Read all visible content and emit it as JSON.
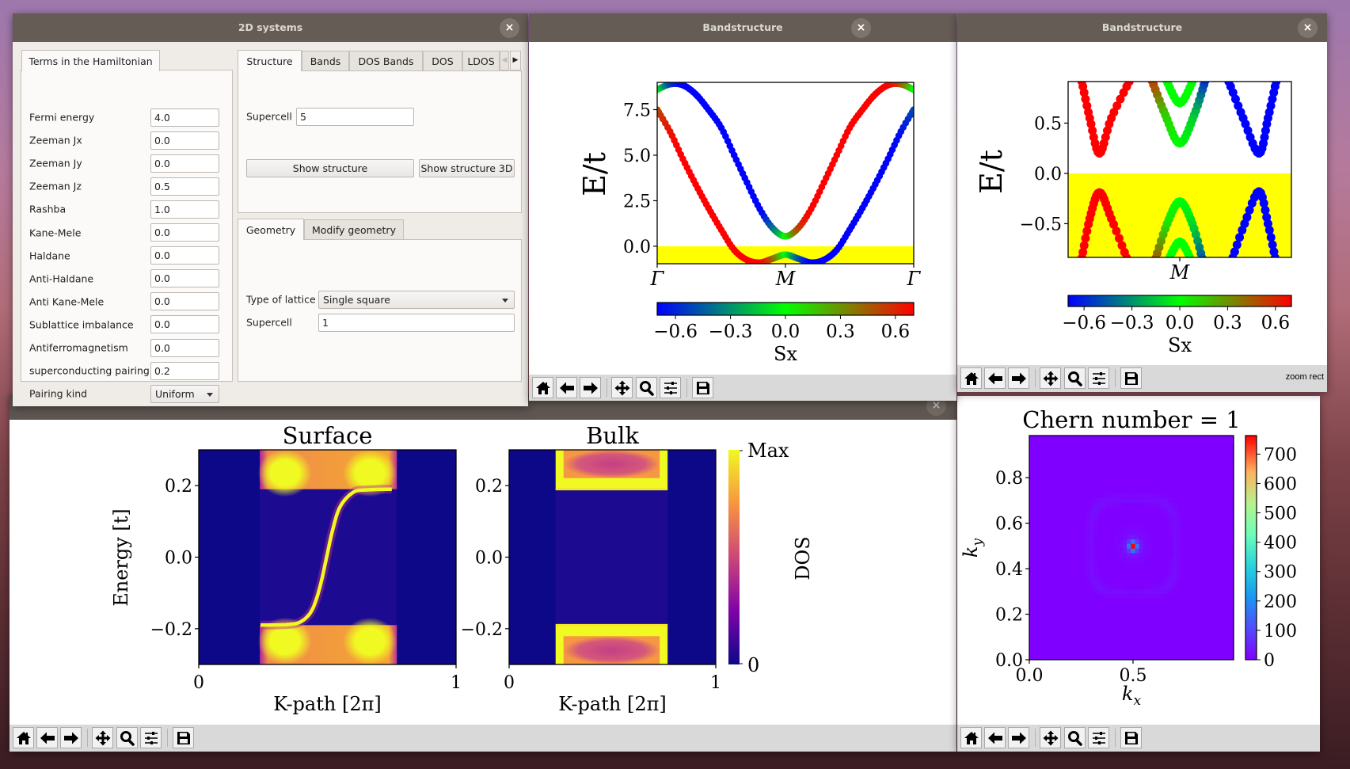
{
  "systems": {
    "title": "2D systems",
    "close_icon": "close-icon",
    "hamiltonian_tab": "Terms in the Hamiltonian",
    "params": [
      {
        "label": "Fermi energy",
        "value": "4.0"
      },
      {
        "label": "Zeeman Jx",
        "value": "0.0"
      },
      {
        "label": "Zeeman Jy",
        "value": "0.0"
      },
      {
        "label": "Zeeman Jz",
        "value": "0.5"
      },
      {
        "label": "Rashba",
        "value": "1.0"
      },
      {
        "label": "Kane-Mele",
        "value": "0.0"
      },
      {
        "label": "Haldane",
        "value": "0.0"
      },
      {
        "label": "Anti-Haldane",
        "value": "0.0"
      },
      {
        "label": "Anti Kane-Mele",
        "value": "0.0"
      },
      {
        "label": "Sublattice imbalance",
        "value": "0.0"
      },
      {
        "label": "Antiferromagnetism",
        "value": "0.0"
      },
      {
        "label": "superconducting pairing",
        "value": "0.2"
      }
    ],
    "pairing_kind": {
      "label": "Pairing kind",
      "value": "Uniform"
    },
    "top_tabs": [
      "Structure",
      "Bands",
      "DOS Bands",
      "DOS",
      "LDOS"
    ],
    "supercell_label": "Supercell",
    "supercell_value": "5",
    "show_structure": "Show structure",
    "show_structure_3d": "Show structure 3D",
    "bottom_tabs": [
      "Geometry",
      "Modify geometry"
    ],
    "lattice_label": "Type of lattice",
    "lattice_value": "Single square",
    "geom_supercell_label": "Supercell",
    "geom_supercell_value": "1"
  },
  "band1": {
    "title": "Bandstructure"
  },
  "band2": {
    "title": "Bandstructure",
    "toolbar_message": "zoom rect"
  },
  "toolbar_buttons": [
    "home-icon",
    "back-arrow-icon",
    "forward-arrow-icon",
    "pan-move-icon",
    "zoom-magnifier-icon",
    "configure-subplots-icon",
    "save-floppy-icon"
  ],
  "colors": {
    "fermi_sea": "#ffff00",
    "sx_negative": "#0000ff",
    "sx_zero": "#00ff00",
    "sx_positive": "#ff0000"
  },
  "chart_data": [
    {
      "id": "band1",
      "type": "scatter",
      "ylabel": "E/t",
      "xticklabels": [
        "Γ",
        "M",
        "Γ"
      ],
      "xticks": [
        0,
        0.5,
        1
      ],
      "xlim": [
        0,
        1
      ],
      "ylim": [
        -0.96,
        9.0
      ],
      "yticks": [
        0.0,
        2.5,
        5.0,
        7.5
      ],
      "yticklabels": [
        "0.0",
        "2.5",
        "5.0",
        "7.5"
      ],
      "filled_below_energy": 0.0,
      "colorbar": {
        "label": "Sx",
        "range": [
          -0.7,
          0.7
        ],
        "ticks": [
          -0.6,
          -0.3,
          0.0,
          0.3,
          0.6
        ],
        "ticklabels": [
          "−0.6",
          "−0.3",
          "0.0",
          "0.3",
          "0.6"
        ]
      },
      "series": [
        {
          "x": [
            0,
            0.05,
            0.1,
            0.15,
            0.2,
            0.25,
            0.3,
            0.35,
            0.4,
            0.45,
            0.5,
            0.55,
            0.6,
            0.65,
            0.7,
            0.75,
            0.8,
            0.85,
            0.9,
            0.95,
            1
          ],
          "y": [
            8.6,
            8.9,
            8.85,
            8.35,
            7.5,
            6.5,
            5.0,
            3.5,
            2.05,
            1.0,
            0.55,
            1.0,
            2.05,
            3.5,
            5.0,
            6.5,
            7.5,
            8.35,
            8.85,
            8.9,
            8.6
          ],
          "sx": [
            0,
            -0.5,
            -0.7,
            -0.7,
            -0.7,
            -0.7,
            -0.7,
            -0.7,
            -0.7,
            -0.4,
            0,
            0.5,
            0.7,
            0.7,
            0.7,
            0.7,
            0.7,
            0.7,
            0.7,
            0.5,
            0
          ]
        },
        {
          "x": [
            0,
            0.05,
            0.1,
            0.15,
            0.2,
            0.25,
            0.3,
            0.35,
            0.4,
            0.45,
            0.5,
            0.55,
            0.6,
            0.65,
            0.7,
            0.75,
            0.8,
            0.85,
            0.9,
            0.95,
            1
          ],
          "y": [
            7.5,
            6.3,
            4.8,
            3.4,
            2.1,
            0.9,
            -0.2,
            -0.75,
            -0.9,
            -0.68,
            -0.46,
            -0.68,
            -0.9,
            -0.75,
            -0.2,
            0.9,
            2.1,
            3.4,
            4.8,
            6.3,
            7.5
          ],
          "sx": [
            0.5,
            0.65,
            0.7,
            0.7,
            0.7,
            0.7,
            0.7,
            0.7,
            0.7,
            0.45,
            0,
            -0.45,
            -0.7,
            -0.7,
            -0.7,
            -0.7,
            -0.7,
            -0.7,
            -0.7,
            -0.65,
            -0.5
          ]
        }
      ]
    },
    {
      "id": "band2",
      "type": "scatter",
      "ylabel": "E/t",
      "xticklabels": [
        "M"
      ],
      "xticks": [
        0.5
      ],
      "xlim": [
        0.19,
        0.81
      ],
      "ylim": [
        -0.835,
        0.913
      ],
      "yticks": [
        -0.5,
        0.0,
        0.5
      ],
      "yticklabels": [
        "−0.5",
        "0.0",
        "0.5"
      ],
      "filled_below_energy": 0.0,
      "colorbar": {
        "label": "Sx",
        "range": [
          -0.7,
          0.7
        ],
        "ticks": [
          -0.6,
          -0.3,
          0.0,
          0.3,
          0.6
        ],
        "ticklabels": [
          "−0.6",
          "−0.3",
          "0.0",
          "0.3",
          "0.6"
        ]
      },
      "series": [
        {
          "x": [
            0.226,
            0.25,
            0.277,
            0.31,
            0.365
          ],
          "y": [
            0.95,
            0.55,
            0.2,
            0.55,
            0.95
          ],
          "sx": [
            0.7,
            0.7,
            0.7,
            0.7,
            0.7
          ]
        },
        {
          "x": [
            0.42,
            0.46,
            0.5,
            0.54,
            0.573
          ],
          "y": [
            0.95,
            0.58,
            0.3,
            0.58,
            0.95
          ],
          "sx": [
            0.6,
            0.15,
            0,
            -0.15,
            -0.6
          ]
        },
        {
          "x": [
            0.46,
            0.5,
            0.54
          ],
          "y": [
            0.95,
            0.7,
            0.95
          ],
          "sx": [
            0,
            0,
            0
          ]
        },
        {
          "x": [
            0.632,
            0.676,
            0.72,
            0.745,
            0.77
          ],
          "y": [
            0.95,
            0.55,
            0.2,
            0.55,
            0.95
          ],
          "sx": [
            -0.7,
            -0.7,
            -0.7,
            -0.7,
            -0.7
          ]
        },
        {
          "x": [
            0.226,
            0.25,
            0.277,
            0.31,
            0.357
          ],
          "y": [
            -0.88,
            -0.45,
            -0.19,
            -0.45,
            -0.88
          ],
          "sx": [
            0.7,
            0.7,
            0.7,
            0.7,
            0.7
          ]
        },
        {
          "x": [
            0.43,
            0.465,
            0.5,
            0.535,
            0.565
          ],
          "y": [
            -0.88,
            -0.5,
            -0.28,
            -0.5,
            -0.88
          ],
          "sx": [
            0.5,
            0.1,
            0,
            -0.1,
            -0.5
          ]
        },
        {
          "x": [
            0.466,
            0.5,
            0.534
          ],
          "y": [
            -0.88,
            -0.68,
            -0.88
          ],
          "sx": [
            0,
            0,
            0
          ]
        },
        {
          "x": [
            0.643,
            0.68,
            0.72,
            0.745,
            0.767
          ],
          "y": [
            -0.88,
            -0.5,
            -0.18,
            -0.5,
            -0.88
          ],
          "sx": [
            -0.7,
            -0.7,
            -0.7,
            -0.7,
            -0.7
          ]
        }
      ]
    },
    {
      "id": "surface",
      "type": "heatmap",
      "title": "Surface",
      "xlabel": "K-path [2π]",
      "ylabel": "Energy [t]",
      "xlim": [
        0,
        1
      ],
      "ylim": [
        -0.3,
        0.3
      ],
      "xticks": [
        0,
        1
      ],
      "xticklabels": [
        "0",
        "1"
      ],
      "yticks": [
        -0.2,
        0.0,
        0.2
      ],
      "yticklabels": [
        "−0.2",
        "0.0",
        "0.2"
      ],
      "bulk_continuum_k": [
        0.237,
        0.77
      ],
      "gap_edges": [
        -0.19,
        0.19
      ],
      "edge_state": {
        "k": [
          0.24,
          0.35,
          0.4,
          0.44,
          0.47,
          0.497,
          0.52,
          0.55,
          0.6,
          0.65,
          0.75
        ],
        "E": [
          -0.19,
          -0.188,
          -0.179,
          -0.148,
          -0.086,
          0,
          0.075,
          0.142,
          0.181,
          0.188,
          0.19
        ]
      }
    },
    {
      "id": "bulk",
      "type": "heatmap",
      "title": "Bulk",
      "xlabel": "K-path [2π]",
      "xlim": [
        0,
        1
      ],
      "ylim": [
        -0.3,
        0.3
      ],
      "xticks": [
        0,
        1
      ],
      "xticklabels": [
        "0",
        "1"
      ],
      "yticks": [
        -0.2,
        0.0,
        0.2
      ],
      "yticklabels": [
        "−0.2",
        "0.0",
        "0.2"
      ],
      "bulk_continuum_k": [
        0.225,
        0.767
      ],
      "gap_edges": [
        -0.19,
        0.19
      ],
      "colorbar": {
        "label": "DOS",
        "ticklabels": [
          "0",
          "Max"
        ],
        "colormap": "plasma"
      }
    },
    {
      "id": "chern",
      "type": "heatmap",
      "title": "Chern number = 1",
      "xlabel": "k_x",
      "ylabel": "k_y",
      "xlim": [
        0,
        0.985
      ],
      "ylim": [
        0,
        0.985
      ],
      "xticks": [
        0.0,
        0.5
      ],
      "xticklabels": [
        "0.0",
        "0.5"
      ],
      "yticks": [
        0.0,
        0.2,
        0.4,
        0.6,
        0.8
      ],
      "yticklabels": [
        "0.0",
        "0.2",
        "0.4",
        "0.6",
        "0.8"
      ],
      "peak": {
        "kx": 0.5,
        "ky": 0.5,
        "value": 763
      },
      "colorbar": {
        "range": [
          0,
          763
        ],
        "ticks": [
          0,
          100,
          200,
          300,
          400,
          500,
          600,
          700
        ],
        "ticklabels": [
          "0",
          "100",
          "200",
          "300",
          "400",
          "500",
          "600",
          "700"
        ],
        "colormap": "rainbow"
      }
    }
  ]
}
